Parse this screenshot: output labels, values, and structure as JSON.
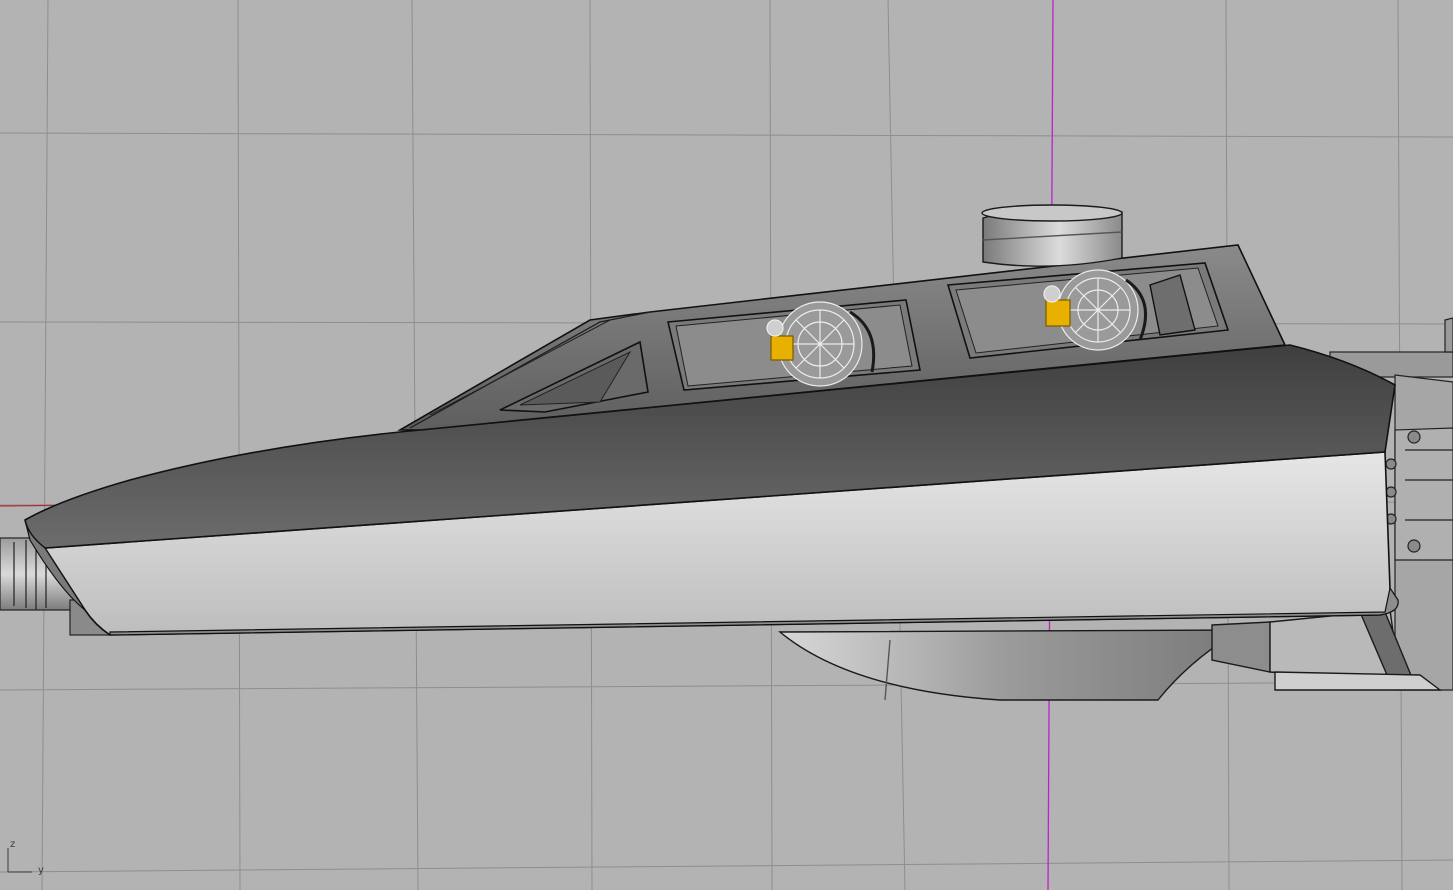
{
  "viewport": {
    "title": "",
    "background": "#b3b3b3",
    "grid_color": "#8f8f8f",
    "x_axis_color": "#b03030",
    "z_axis_color": "#c020c8"
  },
  "model": {
    "hull_dark": "#5a5a5a",
    "hull_light": "#d2d2d2",
    "outline": "#111111",
    "pilot_highlight": "#e8b000"
  },
  "axis_widget": {
    "z_label": "z",
    "y_label": "y"
  }
}
